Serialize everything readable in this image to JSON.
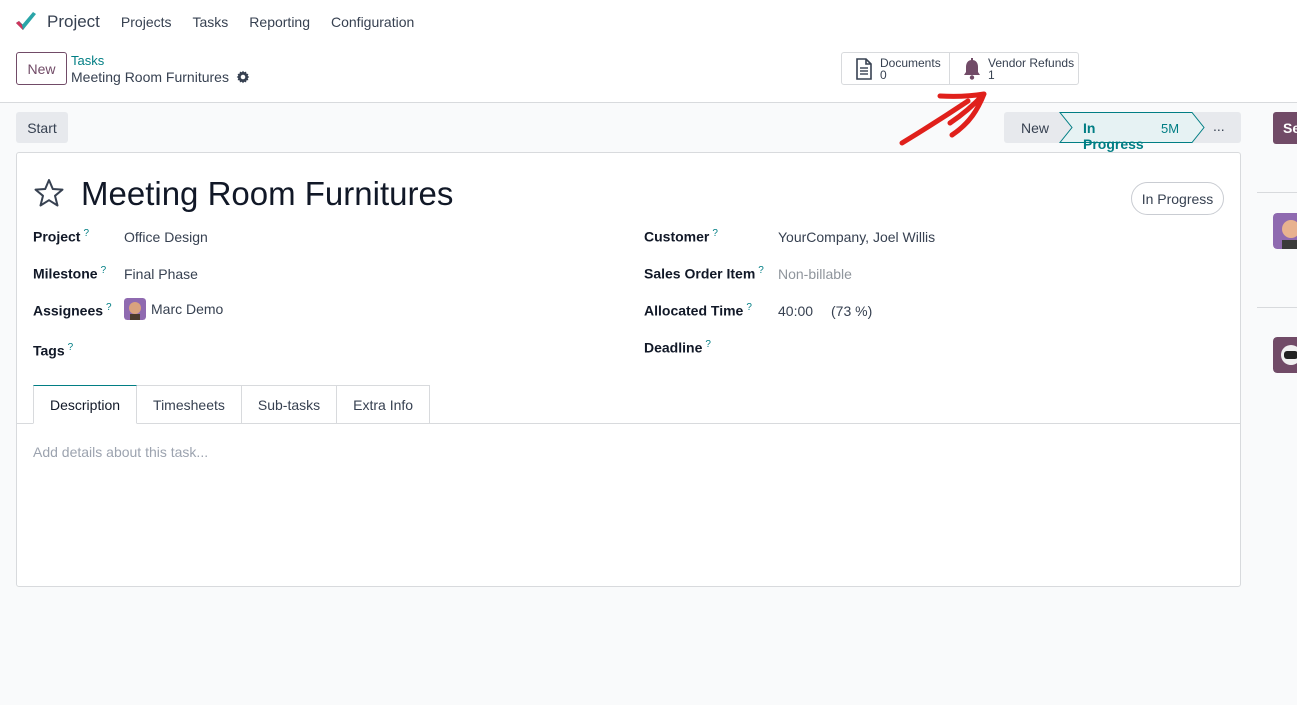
{
  "nav": {
    "app_name": "Project",
    "menu": [
      "Projects",
      "Tasks",
      "Reporting",
      "Configuration"
    ]
  },
  "control": {
    "new_label": "New",
    "breadcrumb_parent": "Tasks",
    "breadcrumb_current": "Meeting Room Furnitures"
  },
  "smart_buttons": {
    "documents": {
      "label": "Documents",
      "count": "0"
    },
    "vendor_refunds": {
      "label": "Vendor Refunds",
      "count": "1"
    }
  },
  "status": {
    "start_label": "Start",
    "stages": [
      "New",
      "In Progress",
      "..."
    ],
    "active_stage": "In Progress",
    "active_stage_time": "5M",
    "side_button_label": "Se"
  },
  "task": {
    "title": "Meeting Room Furnitures",
    "state_badge": "In Progress",
    "left_fields": [
      {
        "label": "Project",
        "value": "Office Design"
      },
      {
        "label": "Milestone",
        "value": "Final Phase"
      },
      {
        "label": "Assignees",
        "value": "Marc Demo"
      },
      {
        "label": "Tags",
        "value": ""
      }
    ],
    "right_fields": [
      {
        "label": "Customer",
        "value": "YourCompany, Joel Willis"
      },
      {
        "label": "Sales Order Item",
        "value": "Non-billable"
      },
      {
        "label": "Allocated Time",
        "value": "40:00",
        "extra": "(73 %)"
      },
      {
        "label": "Deadline",
        "value": ""
      }
    ],
    "tabs": [
      "Description",
      "Timesheets",
      "Sub-tasks",
      "Extra Info"
    ],
    "active_tab": "Description",
    "description_placeholder": "Add details about this task..."
  },
  "colors": {
    "brand": "#714b67",
    "accent": "#017e84",
    "annotation": "#e0201b"
  },
  "icons": [
    "app-logo-icon",
    "gear-icon",
    "document-icon",
    "bell-icon",
    "star-icon",
    "help-icon"
  ]
}
